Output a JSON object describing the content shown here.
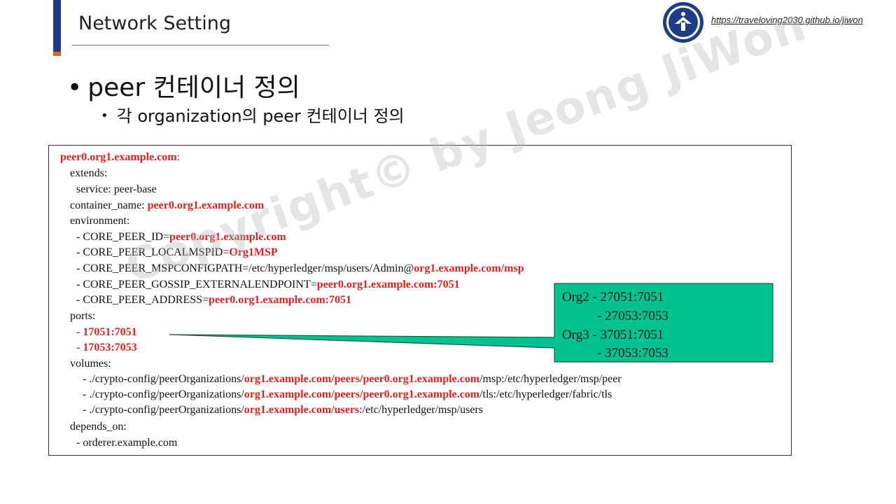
{
  "header": {
    "title": "Network Setting",
    "site_link": "https://traveloving2030.github.io/jiwon",
    "logo_icon": "university-seal-icon"
  },
  "bullets": {
    "level1": "peer 컨테이너 정의",
    "level2": "각 organization의 peer 컨테이너 정의"
  },
  "code": {
    "l1": {
      "a": "peer0.org1.example.com",
      "b": ":"
    },
    "l2": {
      "a": "extends:"
    },
    "l3": {
      "a": "service: peer-base"
    },
    "l4": {
      "a": "container_name: ",
      "b": "peer0.org1.example.com"
    },
    "l5": {
      "a": "environment:"
    },
    "l6": {
      "a": "- CORE_PEER_ID=",
      "b": "peer0.org1.example.com"
    },
    "l7": {
      "a": "- CORE_PEER_LOCALMSPID=",
      "b": "Org1MSP"
    },
    "l8": {
      "a": "- CORE_PEER_MSPCONFIGPATH=/etc/hyperledger/msp/users/Admin@",
      "b": "org1.example.com/msp"
    },
    "l9": {
      "a": "- CORE_PEER_GOSSIP_EXTERNALENDPOINT=",
      "b": "peer0.org1.example.com:7051"
    },
    "l10": {
      "a": "- CORE_PEER_ADDRESS=",
      "b": "peer0.org1.example.com:7051"
    },
    "l11": {
      "a": "ports:"
    },
    "l12": {
      "a": "- 17051:7051"
    },
    "l13": {
      "a": "- 17053:7053"
    },
    "l14": {
      "a": "volumes:"
    },
    "l15": {
      "a": "- ./crypto-config/peerOrganizations/",
      "b": "org1.example.com/peers/peer0.org1.example.com",
      "c": "/msp:/etc/hyperledger/msp/peer"
    },
    "l16": {
      "a": "- ./crypto-config/peerOrganizations/",
      "b": "org1.example.com/peers/peer0.org1.example.com",
      "c": "/tls:/etc/hyperledger/fabric/tls"
    },
    "l17": {
      "a": "- ./crypto-config/peerOrganizations/",
      "b": "org1.example.com/users",
      "c": ":/etc/hyperledger/msp/users"
    },
    "l18": {
      "a": "depends_on:"
    },
    "l19": {
      "a": "- orderer.example.com"
    }
  },
  "callout": {
    "line1": "Org2 - 27051:7051",
    "line2": "- 27053:7053",
    "line3": "Org3 - 37051:7051",
    "line4": "- 37053:7053",
    "fill_color": "#00c38f"
  },
  "watermark": "Copyright© by Jeong JiWon",
  "colors": {
    "accent": "#1f3c88",
    "accent_secondary": "#e0651e",
    "code_highlight": "#e32020"
  }
}
